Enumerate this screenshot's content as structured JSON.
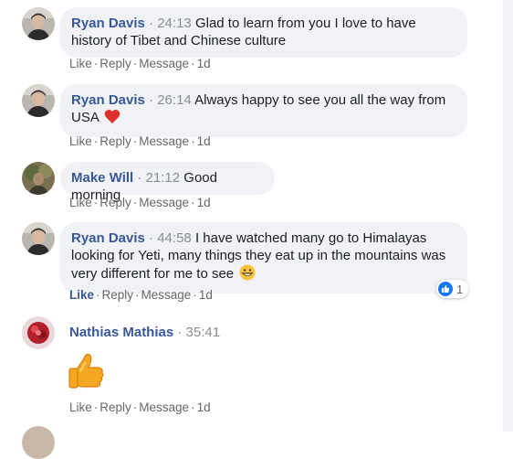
{
  "comments": [
    {
      "author": "Ryan Davis",
      "time": "24:13",
      "text": "Glad to learn from you I love to have history of Tibet and Chinese culture",
      "emoji": "",
      "actions": {
        "like": "Like",
        "reply": "Reply",
        "message": "Message",
        "age": "1d"
      }
    },
    {
      "author": "Ryan Davis",
      "time": "26:14",
      "text": "Always happy to see you all the way from USA",
      "emoji": "red-heart",
      "actions": {
        "like": "Like",
        "reply": "Reply",
        "message": "Message",
        "age": "1d"
      }
    },
    {
      "author": "Make Will",
      "time": "21:12",
      "text": "Good morning",
      "emoji": "",
      "actions": {
        "like": "Like",
        "reply": "Reply",
        "message": "Message",
        "age": "1d"
      }
    },
    {
      "author": "Ryan Davis",
      "time": "44:58",
      "text": "I have watched many go to Himalayas looking for Yeti, many things they eat up in the mountains was very different for me to see",
      "emoji": "grinning-face",
      "actions": {
        "like": "Like",
        "reply": "Reply",
        "message": "Message",
        "age": "1d"
      },
      "liked": true,
      "reaction": {
        "icon": "thumbs-up-icon",
        "count": "1"
      }
    },
    {
      "author": "Nathias Mathias",
      "time": "35:41",
      "text": "",
      "sticker": "thumbs-up-sticker",
      "actions": {
        "like": "Like",
        "reply": "Reply",
        "message": "Message",
        "age": "1d"
      }
    }
  ],
  "colors": {
    "author": "#385898",
    "bubble": "#f0f2f5",
    "meta": "#65676b",
    "like_blue": "#1877f2"
  }
}
